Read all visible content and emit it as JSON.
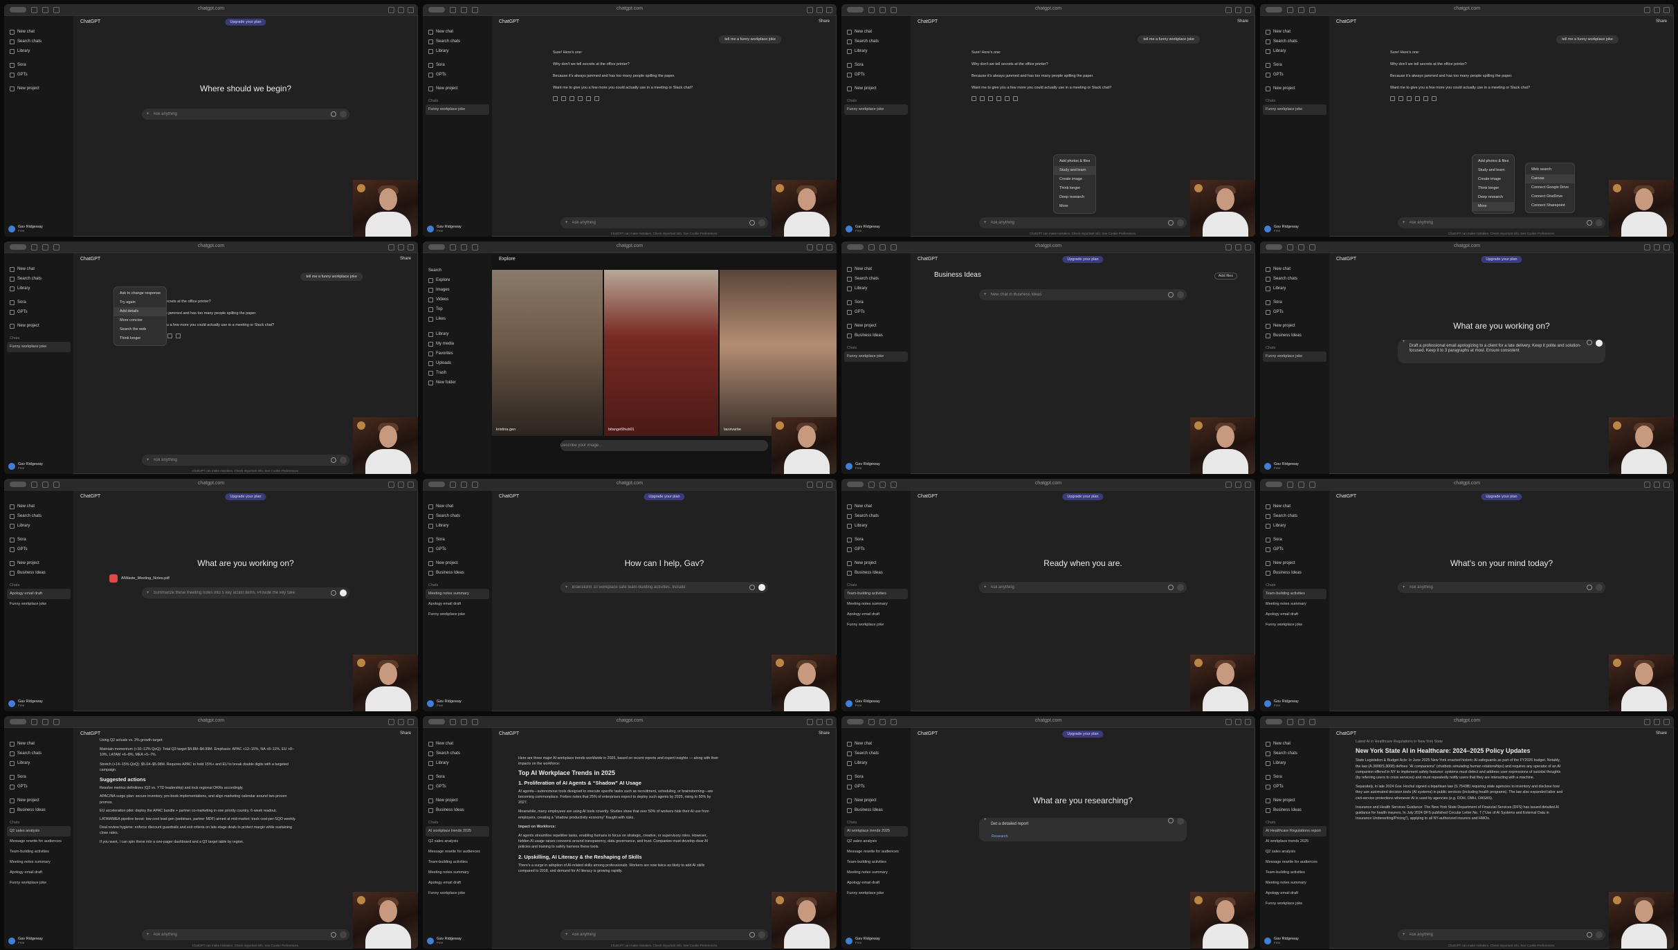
{
  "app": {
    "url": "chatgpt.com",
    "model": "ChatGPT",
    "upgrade_label": "Upgrade your plan",
    "share_label": "Share",
    "user_name": "Gav Ridgeway",
    "user_plan": "Free",
    "footer": "ChatGPT can make mistakes. Check important info. See Cookie Preferences."
  },
  "sidebar": {
    "items": [
      "New chat",
      "Search chats",
      "Library",
      "Sora",
      "GPTs",
      "New project"
    ],
    "chats_label": "Chats"
  },
  "panels": {
    "p1": {
      "heading": "Where should we begin?",
      "placeholder": "Ask anything"
    },
    "p2": {
      "user_msg": "tell me a funny workplace joke",
      "reply": [
        "Sure! Here's one:",
        "Why don't we tell secrets at the office printer?",
        "Because it's always jammed and has too many people spilling the paper.",
        "Want me to give you a few more you could actually use in a meeting or Slack chat?"
      ],
      "chat": "Funny workplace joke",
      "placeholder": "Ask anything"
    },
    "p3": {
      "menu": [
        "Add photos & files",
        "Study and learn",
        "Create image",
        "Think longer",
        "Deep research",
        "More"
      ]
    },
    "p4": {
      "menu": [
        "Add photos & files",
        "Study and learn",
        "Create image",
        "Think longer",
        "Deep research",
        "More"
      ],
      "submenu": [
        "Web search",
        "Canvas",
        "Connect Google Drive",
        "Connect OneDrive",
        "Connect Sharepoint"
      ]
    },
    "p5": {
      "menu": [
        "Try again",
        "Add details",
        "More concise",
        "Search the web",
        "Think longer"
      ],
      "menu_title": "Ask to change response"
    },
    "p6": {
      "title": "Explore",
      "url": "sora.chatgpt.com",
      "nav": [
        "Explore",
        "Images",
        "Videos",
        "Top",
        "Likes",
        "Library",
        "My media",
        "Favorites",
        "Uploads",
        "Trash",
        "New folder"
      ],
      "search": "Search",
      "prompt": "Describe your image...",
      "authors": [
        "kristina.gen",
        "bitangel9hub01",
        "lauvivarbe"
      ]
    },
    "p7": {
      "folder": "Business Ideas",
      "placeholder": "New chat in Business Ideas",
      "files": "Add files"
    },
    "p8": {
      "heading": "What are you working on?",
      "draft": "Draft a professional email apologizing to a client for a late delivery. Keep it polite and solution-focused. Keep it to 3 paragraphs at most. Ensure consistent"
    },
    "p9": {
      "heading": "What are you working on?",
      "file": "AIWaste_Meeting_Notes.pdf",
      "draft": "Summarize these meeting notes into 5 key action items. Provide the key take"
    },
    "p10": {
      "heading": "How can I help, Gav?",
      "draft": "Brainstorm 10 workplace safe team-building activities. Include"
    },
    "p11": {
      "heading": "Ready when you are.",
      "placeholder": "Ask anything"
    },
    "p12": {
      "heading": "What's on your mind today?",
      "placeholder": "Ask anything"
    },
    "p13": {
      "h": "Suggested actions",
      "lines": [
        "Using Q2 actuals vs. 3% growth target:",
        "Maintain momentum (+10–12% QoQ): Total Q3 target $4.8M–$4.99M. Emphasis: APAC +12–15%, NA +8–11%, EU +8–10%, LATAM +6–8%, MEA +5–7%.",
        "Stretch (+14–15% QoQ): $5.04–$5.08M. Requires APAC to hold 15%+ and EU to break double digits with a targeted campaign."
      ],
      "actions": [
        "Resolve metrics definitions (Q2 vs. YTD leadership) and lock regional OKRs accordingly.",
        "APAC/NA surge plan: secure inventory, pre-book implementations, and align marketing calendar around two proven promos.",
        "EU acceleration pilot: deploy the APAC bundle + partner co-marketing in one priority country, 6-week readout.",
        "LATAM/MEA pipeline boost: low-cost lead gen (webinars, partner MDF) aimed at mid-market; track cost-per-SQO weekly.",
        "Deal review hygiene: enforce discount guardrails and exit criteria on late-stage deals to protect margin while sustaining close rates."
      ],
      "closing": "If you want, I can spin these into a one-pager dashboard and a Q3 target table by region."
    },
    "p14": {
      "intro": "Here are three major AI workplace trends worldwide in 2025, based on recent reports and expert insights — along with their impacts on the workforce:",
      "h": "Top AI Workplace Trends in 2025",
      "t1": "1. Proliferation of AI Agents & “Shadow” AI Usage",
      "b1": "AI agents—autonomous tools designed to execute specific tasks such as recruitment, scheduling, or brainstorming—are becoming commonplace. Forbes notes that 25% of enterprises expect to deploy such agents by 2025, rising to 50% by 2027.",
      "b2": "Meanwhile, many employees are using AI tools covertly. Studies show that over 50% of workers hide their AI use from employers, creating a “shadow productivity economy” fraught with risks.",
      "impact": "Impact on Workforce:",
      "impact_text": "AI agents streamline repetitive tasks, enabling humans to focus on strategic, creative, or supervisory roles. However, hidden AI usage raises concerns around transparency, data governance, and trust. Companies must develop clear AI policies and training to safely harness these tools.",
      "t2": "2. Upskilling, AI Literacy & the Reshaping of Skills",
      "b3": "There's a surge in adoption of AI-related skills among professionals. Workers are now twice as likely to add AI skills compared to 2018, and demand for AI literacy is growing rapidly."
    },
    "p15": {
      "heading": "What are you researching?",
      "placeholder": "Get a detailed report",
      "mode": "Research"
    },
    "p16": {
      "crumb": "Latest AI in Healthcare Regulations in New York State",
      "h": "New York State AI in Healthcare: 2024–2025 Policy Updates",
      "paras": [
        "State Legislation & Budget Acts: In June 2025 New York enacted historic AI safeguards as part of the FY2026 budget. Notably, the law (A.3008/S.3008) defines “AI companions” (chatbots simulating human relationships) and requires any operator of an AI companion offered in NY to implement safety features: systems must detect and address user expressions of suicidal thoughts (by referring users to crisis services) and must repeatedly notify users that they are interacting with a machine.",
        "Separately, in late 2024 Gov. Hochul signed a bipartisan law (S.7543B) requiring state agencies to inventory and disclose how they use automated decision tools (AI systems) in public services (including health programs). The law also expanded labor and civil-service protections whenever AI is used by agencies (e.g. DOH, OMH, OASAS).",
        "Insurance and Health Services Guidance: The New York State Department of Financial Services (DFS) has issued detailed AI guidance for health insurers. In July 2024 DFS published Circular Letter No. 7 (“Use of AI Systems and External Data in Insurance Underwriting/Pricing”), applying to all NY-authorized insurers and HMOs."
      ]
    },
    "sidebar_chats": {
      "p9": [
        "Apology email draft",
        "Funny workplace joke"
      ],
      "p10": [
        "Meeting notes summary",
        "Apology email draft",
        "Funny workplace joke"
      ],
      "p11": [
        "Team-building activities",
        "Meeting notes summary",
        "Apology email draft",
        "Funny workplace joke"
      ],
      "p12": [
        "Team-building activities",
        "Meeting notes summary",
        "Apology email draft",
        "Funny workplace joke"
      ],
      "p13": [
        "Q2 sales analysis",
        "Message rewrite for audiences",
        "Team-building activities",
        "Meeting notes summary",
        "Apology email draft",
        "Funny workplace joke"
      ],
      "p14": [
        "AI workplace trends 2025",
        "Q2 sales analysis",
        "Message rewrite for audiences",
        "Team-building activities",
        "Meeting notes summary",
        "Apology email draft",
        "Funny workplace joke"
      ],
      "p16": [
        "AI Healthcare Regulations report",
        "AI workplace trends 2025",
        "Q2 sales analysis",
        "Message rewrite for audiences",
        "Team-building activities",
        "Meeting notes summary",
        "Apology email draft",
        "Funny workplace joke"
      ]
    }
  }
}
